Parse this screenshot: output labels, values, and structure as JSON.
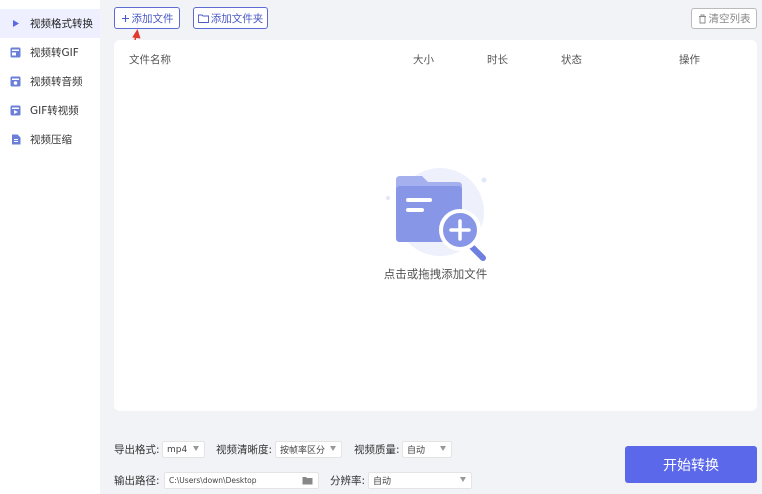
{
  "sidebar": {
    "items": [
      {
        "label": "视频格式转换",
        "icon": "play-icon",
        "active": true
      },
      {
        "label": "视频转GIF",
        "icon": "gif-icon"
      },
      {
        "label": "视频转音频",
        "icon": "audio-icon"
      },
      {
        "label": "GIF转视频",
        "icon": "gif-video-icon"
      },
      {
        "label": "视频压缩",
        "icon": "compress-icon"
      }
    ]
  },
  "toolbar": {
    "add_file_label": "添加文件",
    "add_folder_label": "添加文件夹",
    "clear_list_label": "清空列表"
  },
  "table": {
    "columns": [
      "文件名称",
      "大小",
      "时长",
      "状态",
      "操作"
    ],
    "empty_text": "点击或拖拽添加文件"
  },
  "settings": {
    "format_label": "导出格式:",
    "format_value": "mp4",
    "clarity_label": "视频清晰度:",
    "clarity_value": "按帧率区分",
    "quality_label": "视频质量:",
    "quality_value": "自动",
    "path_label": "输出路径:",
    "path_value": "C:\\Users\\down\\Desktop",
    "resolution_label": "分辨率:",
    "resolution_value": "自动"
  },
  "start_button_label": "开始转换",
  "colors": {
    "accent": "#5b68e9",
    "annotation_arrow": "#e03a2f"
  }
}
